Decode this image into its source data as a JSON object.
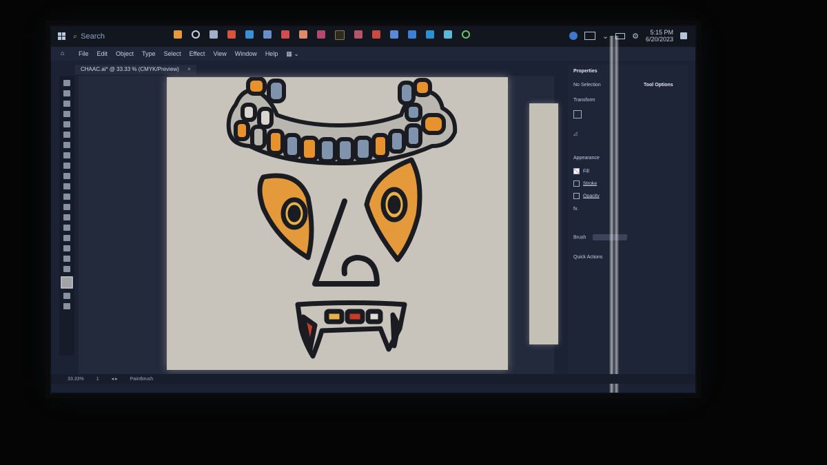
{
  "taskbar": {
    "search_placeholder": "Search",
    "time": "5:15 PM",
    "date": "6/20/2023"
  },
  "menubar": {
    "items": [
      "File",
      "Edit",
      "Object",
      "Type",
      "Select",
      "Effect",
      "View",
      "Window",
      "Help"
    ]
  },
  "document_tab": {
    "title": "CHAAC.ai* @ 33.33 % (CMYK/Preview)",
    "close": "×"
  },
  "panel": {
    "tab_properties": "Properties",
    "no_selection": "No Selection",
    "tool_options": "Tool Options",
    "transform": "Transform",
    "appearance": "Appearance",
    "fill_label": "Fill",
    "stroke_label": "Stroke",
    "opacity_label": "Opacity",
    "fx_label": "fx.",
    "brush_label": "Brush",
    "quick_actions": "Quick Actions"
  },
  "statusbar": {
    "zoom": "33.33%",
    "page": "1",
    "tool_name": "Paintbrush"
  },
  "colors": {
    "artboard": "#c9c4bb",
    "outline": "#1a1c22",
    "orange": "#e8922e",
    "blue_gray": "#7f93ad",
    "red": "#c83a2c"
  }
}
